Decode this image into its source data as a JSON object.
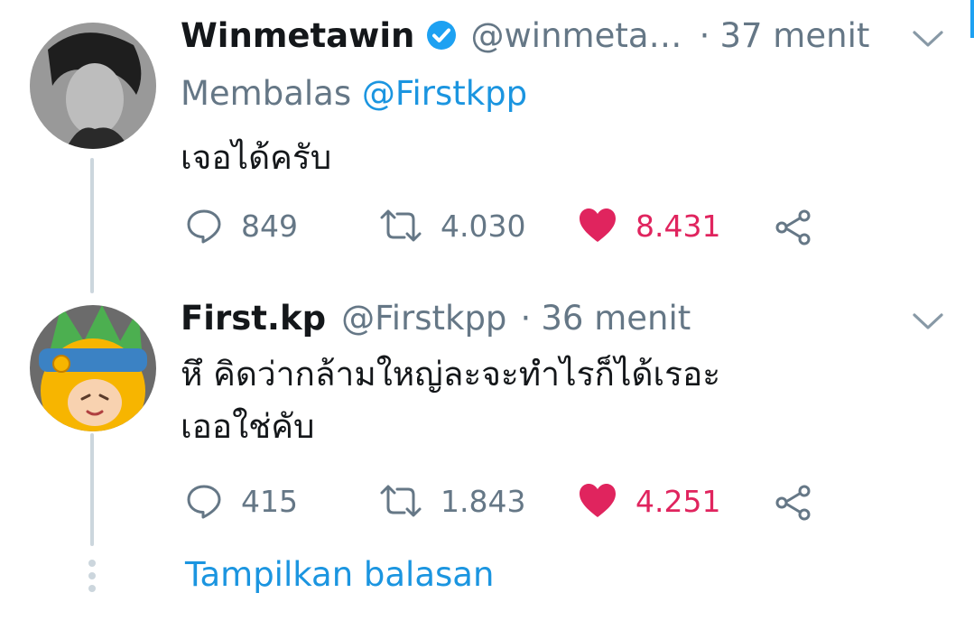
{
  "tweets": [
    {
      "name": "Winmetawin",
      "verified": true,
      "handle": "@winmeta…",
      "separator": "·",
      "time": "37 menit",
      "reply_prefix": "Membalas",
      "reply_mention": "@Firstkpp",
      "text_lines": [
        "เจอได้ครับ"
      ],
      "replies": "849",
      "retweets": "4.030",
      "likes": "8.431",
      "liked": true
    },
    {
      "name": "First.kp",
      "handle": "@Firstkpp",
      "separator": "·",
      "time": "36 menit",
      "text_lines": [
        "หึ คิดว่ากล้ามใหญ่ละจะทำไรก็ได้เรอะ",
        "เออใช่คับ"
      ],
      "replies": "415",
      "retweets": "1.843",
      "likes": "4.251",
      "liked": true
    }
  ],
  "show_replies_label": "Tampilkan balasan",
  "colors": {
    "link": "#1b95e0",
    "like": "#e0245e",
    "muted": "#657786",
    "verified": "#1da1f2"
  },
  "icons": [
    "verified-badge-icon",
    "chevron-down-icon",
    "reply-icon",
    "retweet-icon",
    "heart-icon",
    "share-icon"
  ]
}
